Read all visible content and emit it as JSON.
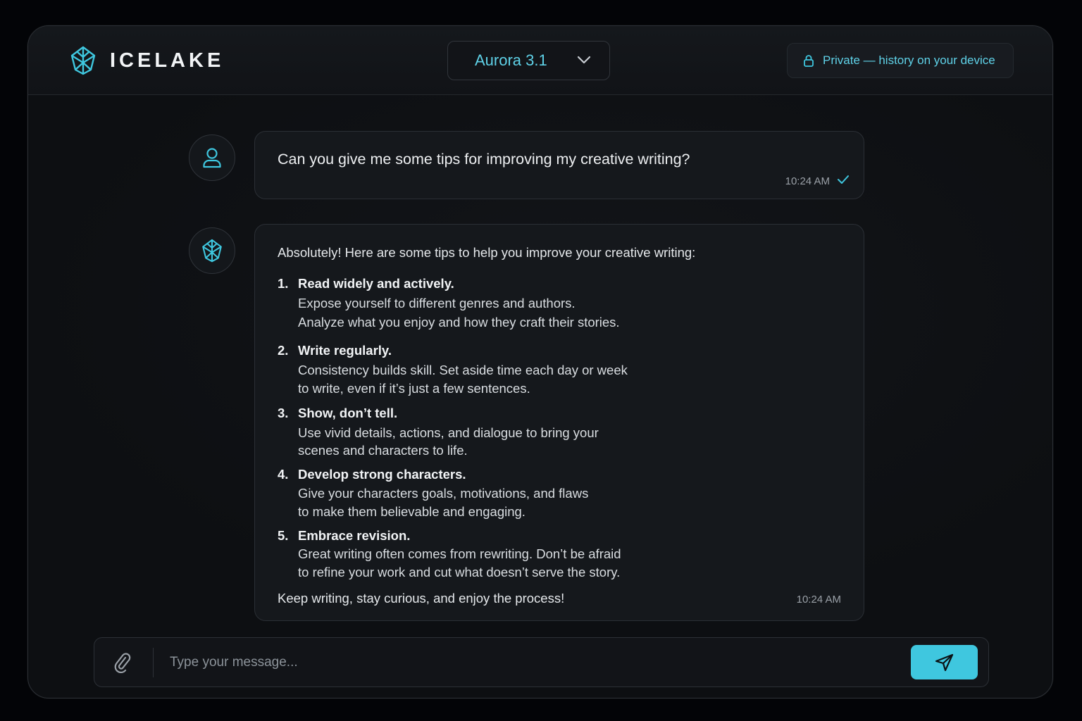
{
  "app": {
    "name": "ICELAKE",
    "accent_color": "#3fc7df"
  },
  "header": {
    "model_label": "Aurora 3.1",
    "model_icon": "chevron-down-icon",
    "privacy_text": "Private — history on your device",
    "privacy_icon": "lock-icon"
  },
  "messages": [
    {
      "role": "user",
      "text": "Can you give me some tips for improving my creative writing?",
      "time": "10:24 AM",
      "status_icon": "check-icon"
    },
    {
      "role": "assistant",
      "intro": "Absolutely! Here are some tips to help you improve your creative writing:",
      "tips": [
        {
          "num": "1.",
          "title": "Read widely and actively.",
          "lines": [
            "Expose yourself to different genres and authors.",
            "Analyze what you enjoy and how they craft their stories."
          ]
        },
        {
          "num": "2.",
          "title": "Write regularly.",
          "lines": [
            "Consistency builds skill. Set aside time each day or week",
            "to write, even if it’s just a few sentences."
          ]
        },
        {
          "num": "3.",
          "title": "Show, don’t tell.",
          "lines": [
            "Use vivid details, actions, and dialogue to bring your",
            "scenes and characters to life."
          ]
        },
        {
          "num": "4.",
          "title": "Develop strong characters.",
          "lines": [
            "Give your characters goals, motivations, and flaws",
            "to make them believable and engaging."
          ]
        },
        {
          "num": "5.",
          "title": "Embrace revision.",
          "lines": [
            "Great writing often comes from rewriting. Don’t be afraid",
            "to refine your work and cut what doesn’t serve the story."
          ]
        }
      ],
      "outro": "Keep writing, stay curious, and enjoy the process!",
      "time": "10:24 AM"
    }
  ],
  "composer": {
    "placeholder": "Type your message...",
    "value": "",
    "attach_icon": "paperclip-icon",
    "send_icon": "send-icon"
  }
}
